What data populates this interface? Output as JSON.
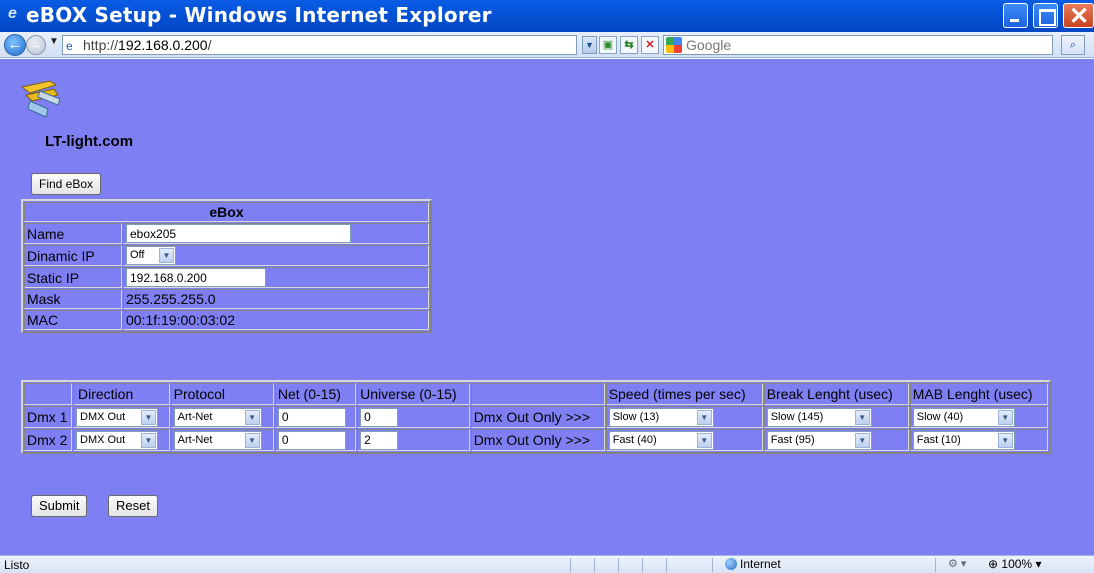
{
  "window": {
    "title": "eBOX Setup - Windows Internet Explorer"
  },
  "addressbar": {
    "url_prefix": "http://",
    "url_host": "192.168.0.200",
    "url_suffix": "/",
    "search_placeholder": "Google"
  },
  "page": {
    "logo_text": "LT-light.com",
    "find_button": "Find eBox",
    "ebox_table": {
      "title": "eBox",
      "rows": [
        {
          "label": "Name",
          "value": "ebox205",
          "kind": "input"
        },
        {
          "label": "Dinamic IP",
          "value": "Off",
          "kind": "select"
        },
        {
          "label": "Static IP",
          "value": "192.168.0.200",
          "kind": "input"
        },
        {
          "label": "Mask",
          "value": "255.255.255.0",
          "kind": "text"
        },
        {
          "label": "MAC",
          "value": "00:1f:19:00:03:02",
          "kind": "text"
        }
      ]
    },
    "dmx_table": {
      "headers": [
        "",
        "Direction",
        "Protocol",
        "Net (0-15)",
        "Universe (0-15)",
        "",
        "Speed (times per sec)",
        "Break Lenght (usec)",
        "MAB Lenght (usec)"
      ],
      "rows": [
        {
          "label": "Dmx 1",
          "direction": "DMX Out",
          "protocol": "Art-Net",
          "net": "0",
          "universe": "0",
          "note": "Dmx Out Only >>>",
          "speed": "Slow (13)",
          "break": "Slow (145)",
          "mab": "Slow (40)"
        },
        {
          "label": "Dmx 2",
          "direction": "DMX Out",
          "protocol": "Art-Net",
          "net": "0",
          "universe": "2",
          "note": "Dmx Out Only >>>",
          "speed": "Fast (40)",
          "break": "Fast (95)",
          "mab": "Fast (10)"
        }
      ]
    },
    "submit_button": "Submit",
    "reset_button": "Reset"
  },
  "statusbar": {
    "status_text": "Listo",
    "zone_text": "Internet",
    "zoom_text": "100%"
  },
  "colors": {
    "page_background": "#7f7ff4",
    "titlebar": "#0553d6"
  },
  "icons": [
    "ie-logo-icon",
    "back-icon",
    "forward-icon",
    "page-icon",
    "compat-view-icon",
    "refresh-icon",
    "stop-icon",
    "google-icon",
    "search-icon",
    "globe-icon",
    "lt-light-logo"
  ]
}
